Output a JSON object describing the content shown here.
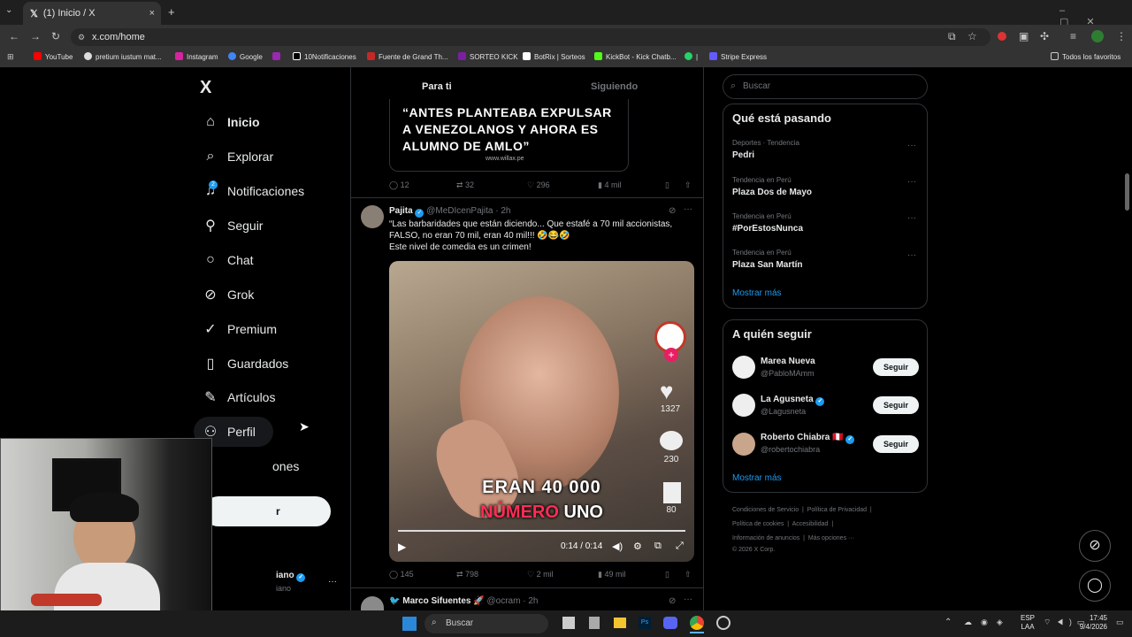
{
  "browser": {
    "tab_title": "(1) Inicio / X",
    "tab_close": "×",
    "new_tab": "+",
    "url": "x.com/home",
    "bookmarks": [
      "YouTube",
      "pretium iustum mat...",
      "Instagram",
      "Google",
      "10Notificaciones",
      "Fuente de Grand Th...",
      "SORTEO KICK",
      "BotRix | Sorteos",
      "KickBot - Kick Chatb...",
      "|",
      "Stripe Express"
    ],
    "all_bookmarks": "Todos los favoritos"
  },
  "nav": {
    "logo": "X",
    "items": [
      "Inicio",
      "Explorar",
      "Notificaciones",
      "Seguir",
      "Chat",
      "Grok",
      "Premium",
      "Guardados",
      "Artículos",
      "Perfil"
    ],
    "notif_badge": "2",
    "more_partial": "ones",
    "post_partial": "r",
    "user_partial": "iano",
    "user_handle_partial": "iano",
    "more_dots": "···"
  },
  "feed": {
    "tabs": [
      "Para ti",
      "Siguiendo"
    ],
    "quote_text": "“ANTES PLANTEABA EXPULSAR A VENEZOLANOS Y AHORA ES ALUMNO DE AMLO”",
    "quote_source": "www.willax.pe",
    "post1_actions": {
      "replies": "12",
      "reposts": "32",
      "likes": "296",
      "views": "4 mil"
    },
    "post2": {
      "name": "Pajita",
      "handle": "@MeDIcenPajita",
      "time": "· 2h",
      "text1": "“Las barbaridades que están diciendo... Que estafé a 70 mil accionistas, FALSO, no eran 70 mil, eran 40 mil!!! 🤣😂🤣",
      "text2": "Este nivel de comedia es un crimen!",
      "video_caption1": "ERAN 40 000",
      "video_caption2a": "NÚMERO",
      "video_caption2b": "UNO",
      "video_time": "0:14 / 0:14",
      "tt_likes": "1327",
      "tt_comments": "230",
      "tt_saves": "80",
      "actions": {
        "replies": "145",
        "reposts": "798",
        "likes": "2 mil",
        "views": "49 mil"
      }
    },
    "post3": {
      "name": "Marco Sifuentes 🚀",
      "handle": "@ocram",
      "time": "· 2h"
    }
  },
  "sidebar": {
    "search_placeholder": "Buscar",
    "trending_title": "Qué está pasando",
    "trends": [
      {
        "meta": "Deportes · Tendencia",
        "name": "Pedri"
      },
      {
        "meta": "Tendencia en Perú",
        "name": "Plaza Dos de Mayo"
      },
      {
        "meta": "Tendencia en Perú",
        "name": "#PorEstosNunca"
      },
      {
        "meta": "Tendencia en Perú",
        "name": "Plaza San Martín"
      }
    ],
    "show_more": "Mostrar más",
    "follow_title": "A quién seguir",
    "follow": [
      {
        "name": "Marea Nueva",
        "handle": "@PabloMAmm",
        "button": "Seguir"
      },
      {
        "name": "La Agusneta",
        "handle": "@Lagusneta",
        "button": "Seguir"
      },
      {
        "name": "Roberto Chiabra 🇵🇪",
        "handle": "@robertochiabra",
        "button": "Seguir"
      }
    ],
    "follow_more": "Mostrar más",
    "footer": [
      "Condiciones de Servicio",
      "Política de Privacidad",
      "Política de cookies",
      "Accesibilidad",
      "Información de anuncios",
      "Más opciones ···",
      "© 2026 X Corp."
    ]
  },
  "taskbar": {
    "search": "Buscar",
    "lang1": "ESP",
    "lang2": "LAA",
    "time": "17:45",
    "date": "9/4/2026"
  },
  "colors": {
    "accent": "#1d9bf0",
    "bg": "#000000",
    "border": "#2f3336",
    "muted": "#71767b"
  }
}
